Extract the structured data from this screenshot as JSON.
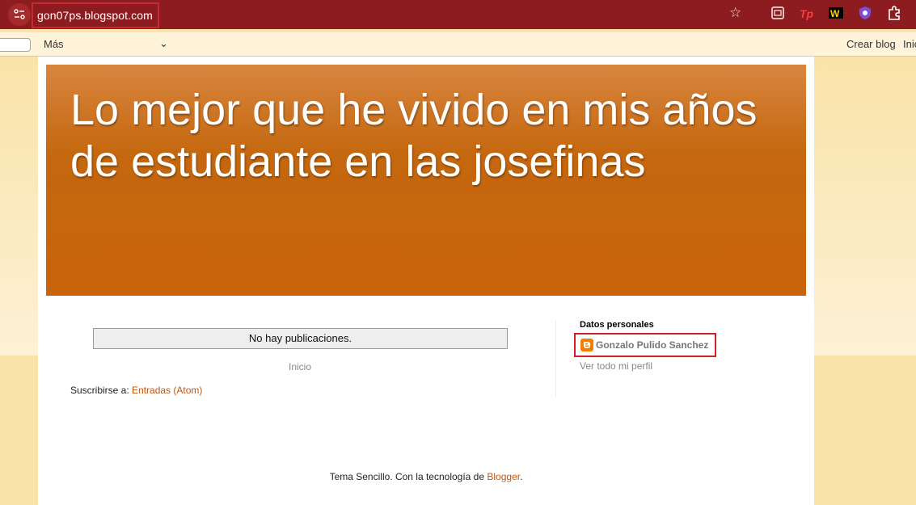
{
  "browser": {
    "url": "gon07ps.blogspot.com",
    "icons": [
      "site-info-icon",
      "bookmark-star-icon",
      "archive-extension-icon",
      "tp-extension-icon",
      "w-extension-icon",
      "shield-extension-icon",
      "puzzle-extensions-icon"
    ]
  },
  "navbar": {
    "more_label": "Más",
    "create_blog": "Crear blog",
    "login": "Inic"
  },
  "blog": {
    "title": "Lo mejor que he vivido en mis años de estudiante en las josefinas"
  },
  "main": {
    "no_posts": "No hay publicaciones.",
    "home_link": "Inicio",
    "subscribe_prefix": "Suscribirse a: ",
    "subscribe_link": "Entradas (Atom)"
  },
  "sidebar": {
    "title": "Datos personales",
    "profile_name": "Gonzalo Pulido Sanchez",
    "profile_link": "Ver todo mi perfil"
  },
  "footer": {
    "text": "Tema Sencillo. Con la tecnología de ",
    "link": "Blogger",
    "end": "."
  },
  "colors": {
    "chrome": "#8d1c20",
    "banner": "#c9640c",
    "link": "#c0560e",
    "highlight": "#d21e24"
  }
}
